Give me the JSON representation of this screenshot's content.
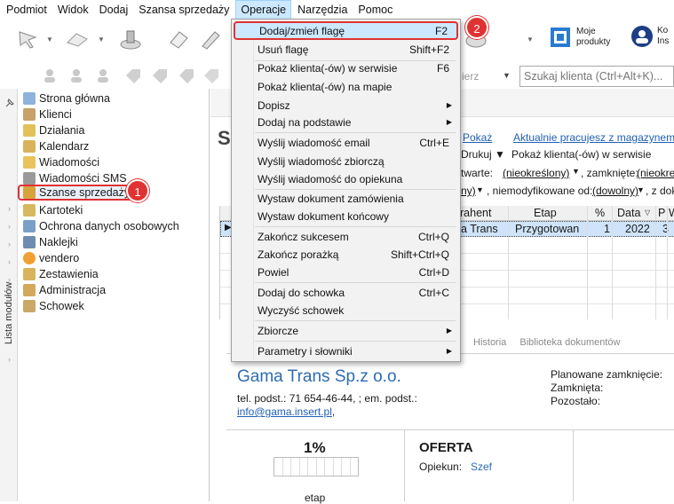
{
  "menubar": {
    "items": [
      "Podmiot",
      "Widok",
      "Dodaj",
      "Szansa sprzedaży",
      "Operacje",
      "Narzędzia",
      "Pomoc"
    ]
  },
  "toolbar": {
    "my_products": "Moje\nprodukty",
    "my_products_l1": "Moje",
    "my_products_l2": "produkty",
    "cut_label_1": "Ko",
    "cut_label_2": "Ins"
  },
  "toolbar2": {
    "dropdown_label": "ierz",
    "search_placeholder": "Szukaj klienta (Ctrl+Alt+K)...",
    "prefix_text": "Drukuj",
    "show_on_service": "Pokaż klienta(-ów) w serwisie",
    "show_link": "Pokaż",
    "currently_working": "Aktualnie pracujesz z magazynem - M"
  },
  "modules": {
    "vertical_label": "Lista modułów",
    "items": [
      "Strona główna",
      "Klienci",
      "Działania",
      "Kalendarz",
      "Wiadomości",
      "Wiadomości SMS",
      "Szanse sprzedaży",
      "Kartoteki",
      "Ochrona danych osobowych",
      "Naklejki",
      "vendero",
      "Zestawienia",
      "Administracja",
      "Schowek"
    ],
    "selected_index": 6
  },
  "badges": {
    "b1": "1",
    "b2": "2"
  },
  "main": {
    "heading_letter": "S",
    "filter_open_label": "twarte:",
    "filter_open_value": "(nieokreślony)",
    "filter_closed_label": ", zamknięte:",
    "filter_closed_value": "(nieokreślo",
    "filter_a_value": "ny)",
    "filter_mod_label": ", niemodyfikowane od:",
    "filter_mod_value": "(dowolny)",
    "filter_z_label": ", z dok",
    "columns": [
      "rahent",
      "Etap",
      "%",
      "Data",
      "P",
      "W"
    ],
    "row": {
      "contractor": "a Trans",
      "stage": "Przygotowan",
      "percent": "1",
      "date": "2022",
      "p": "3"
    },
    "bottom_tabs": [
      "Historia",
      "Biblioteka dokumentów"
    ]
  },
  "detail": {
    "company": "Gama Trans Sp.z o.o.",
    "phone_line": "tel. podst.: 71 654-46-44, ; em. podst.:",
    "email": "info@gama.insert.pl",
    "email_suffix": ",",
    "planned_close": "Planowane zamknięcie:",
    "closed": "Zamknięta:",
    "remaining": "Pozostało:",
    "percent": "1%",
    "stage_label": "etap",
    "offer_title": "OFERTA",
    "owner_label": "Opiekun:",
    "owner_value": "Szef"
  },
  "menu": {
    "items": [
      {
        "label": "Dodaj/zmień flagę",
        "shortcut": "F2"
      },
      {
        "label": "Usuń flagę",
        "shortcut": "Shift+F2"
      },
      {
        "label": "Pokaż klienta(-ów) w serwisie",
        "shortcut": "F6"
      },
      {
        "label": "Pokaż klienta(-ów) na mapie",
        "shortcut": ""
      },
      {
        "label": "Dopisz",
        "shortcut": ""
      },
      {
        "label": "Dodaj na podstawie",
        "shortcut": ""
      },
      {
        "label": "Wyślij wiadomość email",
        "shortcut": "Ctrl+E"
      },
      {
        "label": "Wyślij wiadomość zbiorczą",
        "shortcut": ""
      },
      {
        "label": "Wyślij wiadomość do opiekuna",
        "shortcut": ""
      },
      {
        "label": "Wystaw dokument zamówienia",
        "shortcut": ""
      },
      {
        "label": "Wystaw dokument końcowy",
        "shortcut": ""
      },
      {
        "label": "Zakończ sukcesem",
        "shortcut": "Ctrl+Q"
      },
      {
        "label": "Zakończ porażką",
        "shortcut": "Shift+Ctrl+Q"
      },
      {
        "label": "Powiel",
        "shortcut": "Ctrl+D"
      },
      {
        "label": "Dodaj do schowka",
        "shortcut": "Ctrl+C"
      },
      {
        "label": "Wyczyść schowek",
        "shortcut": ""
      },
      {
        "label": "Zbiorcze",
        "shortcut": ""
      },
      {
        "label": "Parametry i słowniki",
        "shortcut": ""
      }
    ]
  },
  "colors": {
    "accent_red": "#e03232",
    "link_blue": "#1f5fb4",
    "selection": "#cfe4fa"
  }
}
